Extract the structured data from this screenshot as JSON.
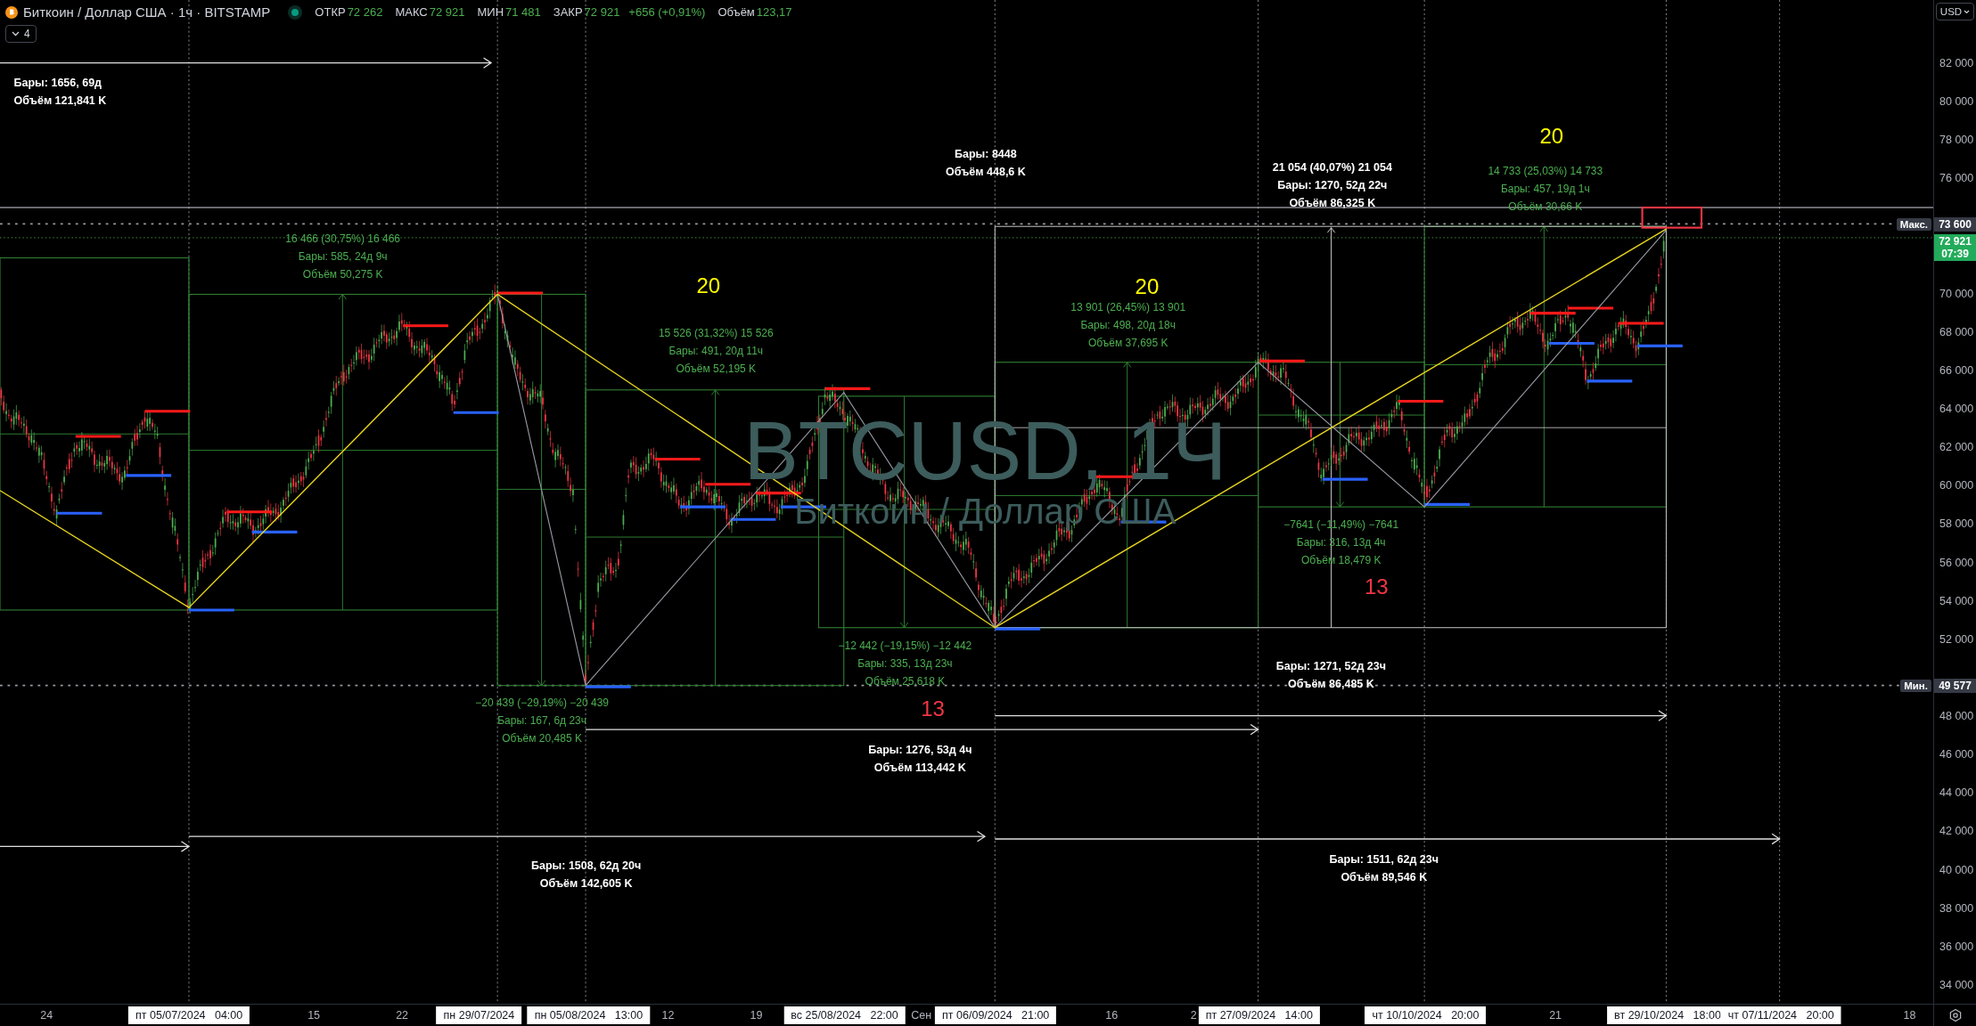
{
  "header": {
    "symbol": "Биткоин / Доллар США · 1ч · BITSTAMP",
    "indicators_count": "4",
    "ohlc": [
      {
        "label": "ОТКР",
        "value": "72 262"
      },
      {
        "label": "МАКС",
        "value": "72 921"
      },
      {
        "label": "МИН",
        "value": "71 481"
      },
      {
        "label": "ЗАКР",
        "value": "72 921"
      }
    ],
    "change": "+656 (+0,91%)",
    "volume": {
      "label": "Объём",
      "value": "123,17"
    }
  },
  "watermark": {
    "ticker": "BTCUSD, 1Ч",
    "name": "Биткоин / Доллар США"
  },
  "annotations": [
    {
      "color": "#ffffff",
      "lines": [
        "Бары: 1656, 69д",
        "Объём 121,841 K"
      ]
    },
    {
      "color": "#4caf50",
      "lines": [
        "16 466 (30,75%) 16 466",
        "Бары: 585, 24д 9ч",
        "Объём 50,275 K"
      ]
    },
    {
      "color": "#4caf50",
      "lines": [
        "15 526 (31,32%) 15 526",
        "Бары: 491, 20д 11ч",
        "Объём 52,195 K"
      ]
    },
    {
      "color": "#ffffff",
      "lines": [
        "Бары: 8448",
        "Объём 448,6 K"
      ]
    },
    {
      "color": "#ffffff",
      "lines": [
        "21 054 (40,07%) 21 054",
        "Бары: 1270, 52д 22ч",
        "Объём 86,325 K"
      ]
    },
    {
      "color": "#4caf50",
      "lines": [
        "14 733 (25,03%) 14 733",
        "Бары: 457, 19д 1ч",
        "Объём 30,66 K"
      ]
    },
    {
      "color": "#4caf50",
      "lines": [
        "13 901 (26,45%) 13 901",
        "Бары: 498, 20д 18ч",
        "Объём 37,695 K"
      ]
    },
    {
      "color": "#4caf50",
      "lines": [
        "−7641 (−11,49%) −7641",
        "Бары: 316, 13д 4ч",
        "Объём 18,479 K"
      ]
    },
    {
      "color": "#4caf50",
      "lines": [
        "−12 442 (−19,15%) −12 442",
        "Бары: 335, 13д 23ч",
        "Объём 25,618 K"
      ]
    },
    {
      "color": "#4caf50",
      "lines": [
        "−20 439 (−29,19%) −20 439",
        "Бары: 167, 6д 23ч",
        "Объём 20,485 K"
      ]
    },
    {
      "color": "#ffffff",
      "lines": [
        "Бары: 1271, 52д 23ч",
        "Объём 86,485 K"
      ]
    },
    {
      "color": "#ffffff",
      "lines": [
        "Бары: 1276, 53д 4ч",
        "Объём 113,442 K"
      ]
    },
    {
      "color": "#ffffff",
      "lines": [
        "Бары: 1508, 62д 20ч",
        "Объём 142,605 K"
      ]
    },
    {
      "color": "#ffffff",
      "lines": [
        "Бары: 1511, 62д 23ч",
        "Объём 89,546 K"
      ]
    }
  ],
  "counts": [
    {
      "text": "20",
      "color": "#ffff00"
    },
    {
      "text": "20",
      "color": "#ffff00"
    },
    {
      "text": "20",
      "color": "#ffff00"
    },
    {
      "text": "13",
      "color": "#f23645"
    },
    {
      "text": "13",
      "color": "#f23645"
    }
  ],
  "price_axis": {
    "currency": "USD",
    "labels": [
      "82 000",
      "80 000",
      "78 000",
      "76 000",
      "70 000",
      "68 000",
      "66 000",
      "64 000",
      "62 000",
      "60 000",
      "58 000",
      "56 000",
      "54 000",
      "52 000",
      "48 000",
      "46 000",
      "44 000",
      "42 000",
      "40 000",
      "38 000",
      "36 000",
      "34 000"
    ],
    "max": {
      "label": "Макс.",
      "value": "73 600"
    },
    "last": {
      "price": "72 921",
      "countdown": "07:39"
    },
    "min": {
      "label": "Мин.",
      "value": "49 577"
    }
  },
  "time_axis": [
    {
      "kind": "tick",
      "text": "24"
    },
    {
      "kind": "marker",
      "text": "пт 05/07/2024   04:00"
    },
    {
      "kind": "tick",
      "text": "15"
    },
    {
      "kind": "tick",
      "text": "22"
    },
    {
      "kind": "marker",
      "text": "пн 29/07/2024"
    },
    {
      "kind": "marker",
      "text": "пн 05/08/2024   13:00"
    },
    {
      "kind": "tick",
      "text": "12"
    },
    {
      "kind": "tick",
      "text": "19"
    },
    {
      "kind": "marker",
      "text": "вс 25/08/2024   22:00"
    },
    {
      "kind": "tick",
      "text": "Сен"
    },
    {
      "kind": "marker",
      "text": "пт 06/09/2024   21:00"
    },
    {
      "kind": "tick",
      "text": "16"
    },
    {
      "kind": "tick",
      "text": "2"
    },
    {
      "kind": "marker",
      "text": "пт 27/09/2024   14:00"
    },
    {
      "kind": "marker",
      "text": "чт 10/10/2024   20:00"
    },
    {
      "kind": "tick",
      "text": "21"
    },
    {
      "kind": "marker",
      "text": "вт 29/10/2024   18:00"
    },
    {
      "kind": "marker",
      "text": "чт 07/11/2024   20:00"
    },
    {
      "kind": "tick",
      "text": "18"
    }
  ]
}
